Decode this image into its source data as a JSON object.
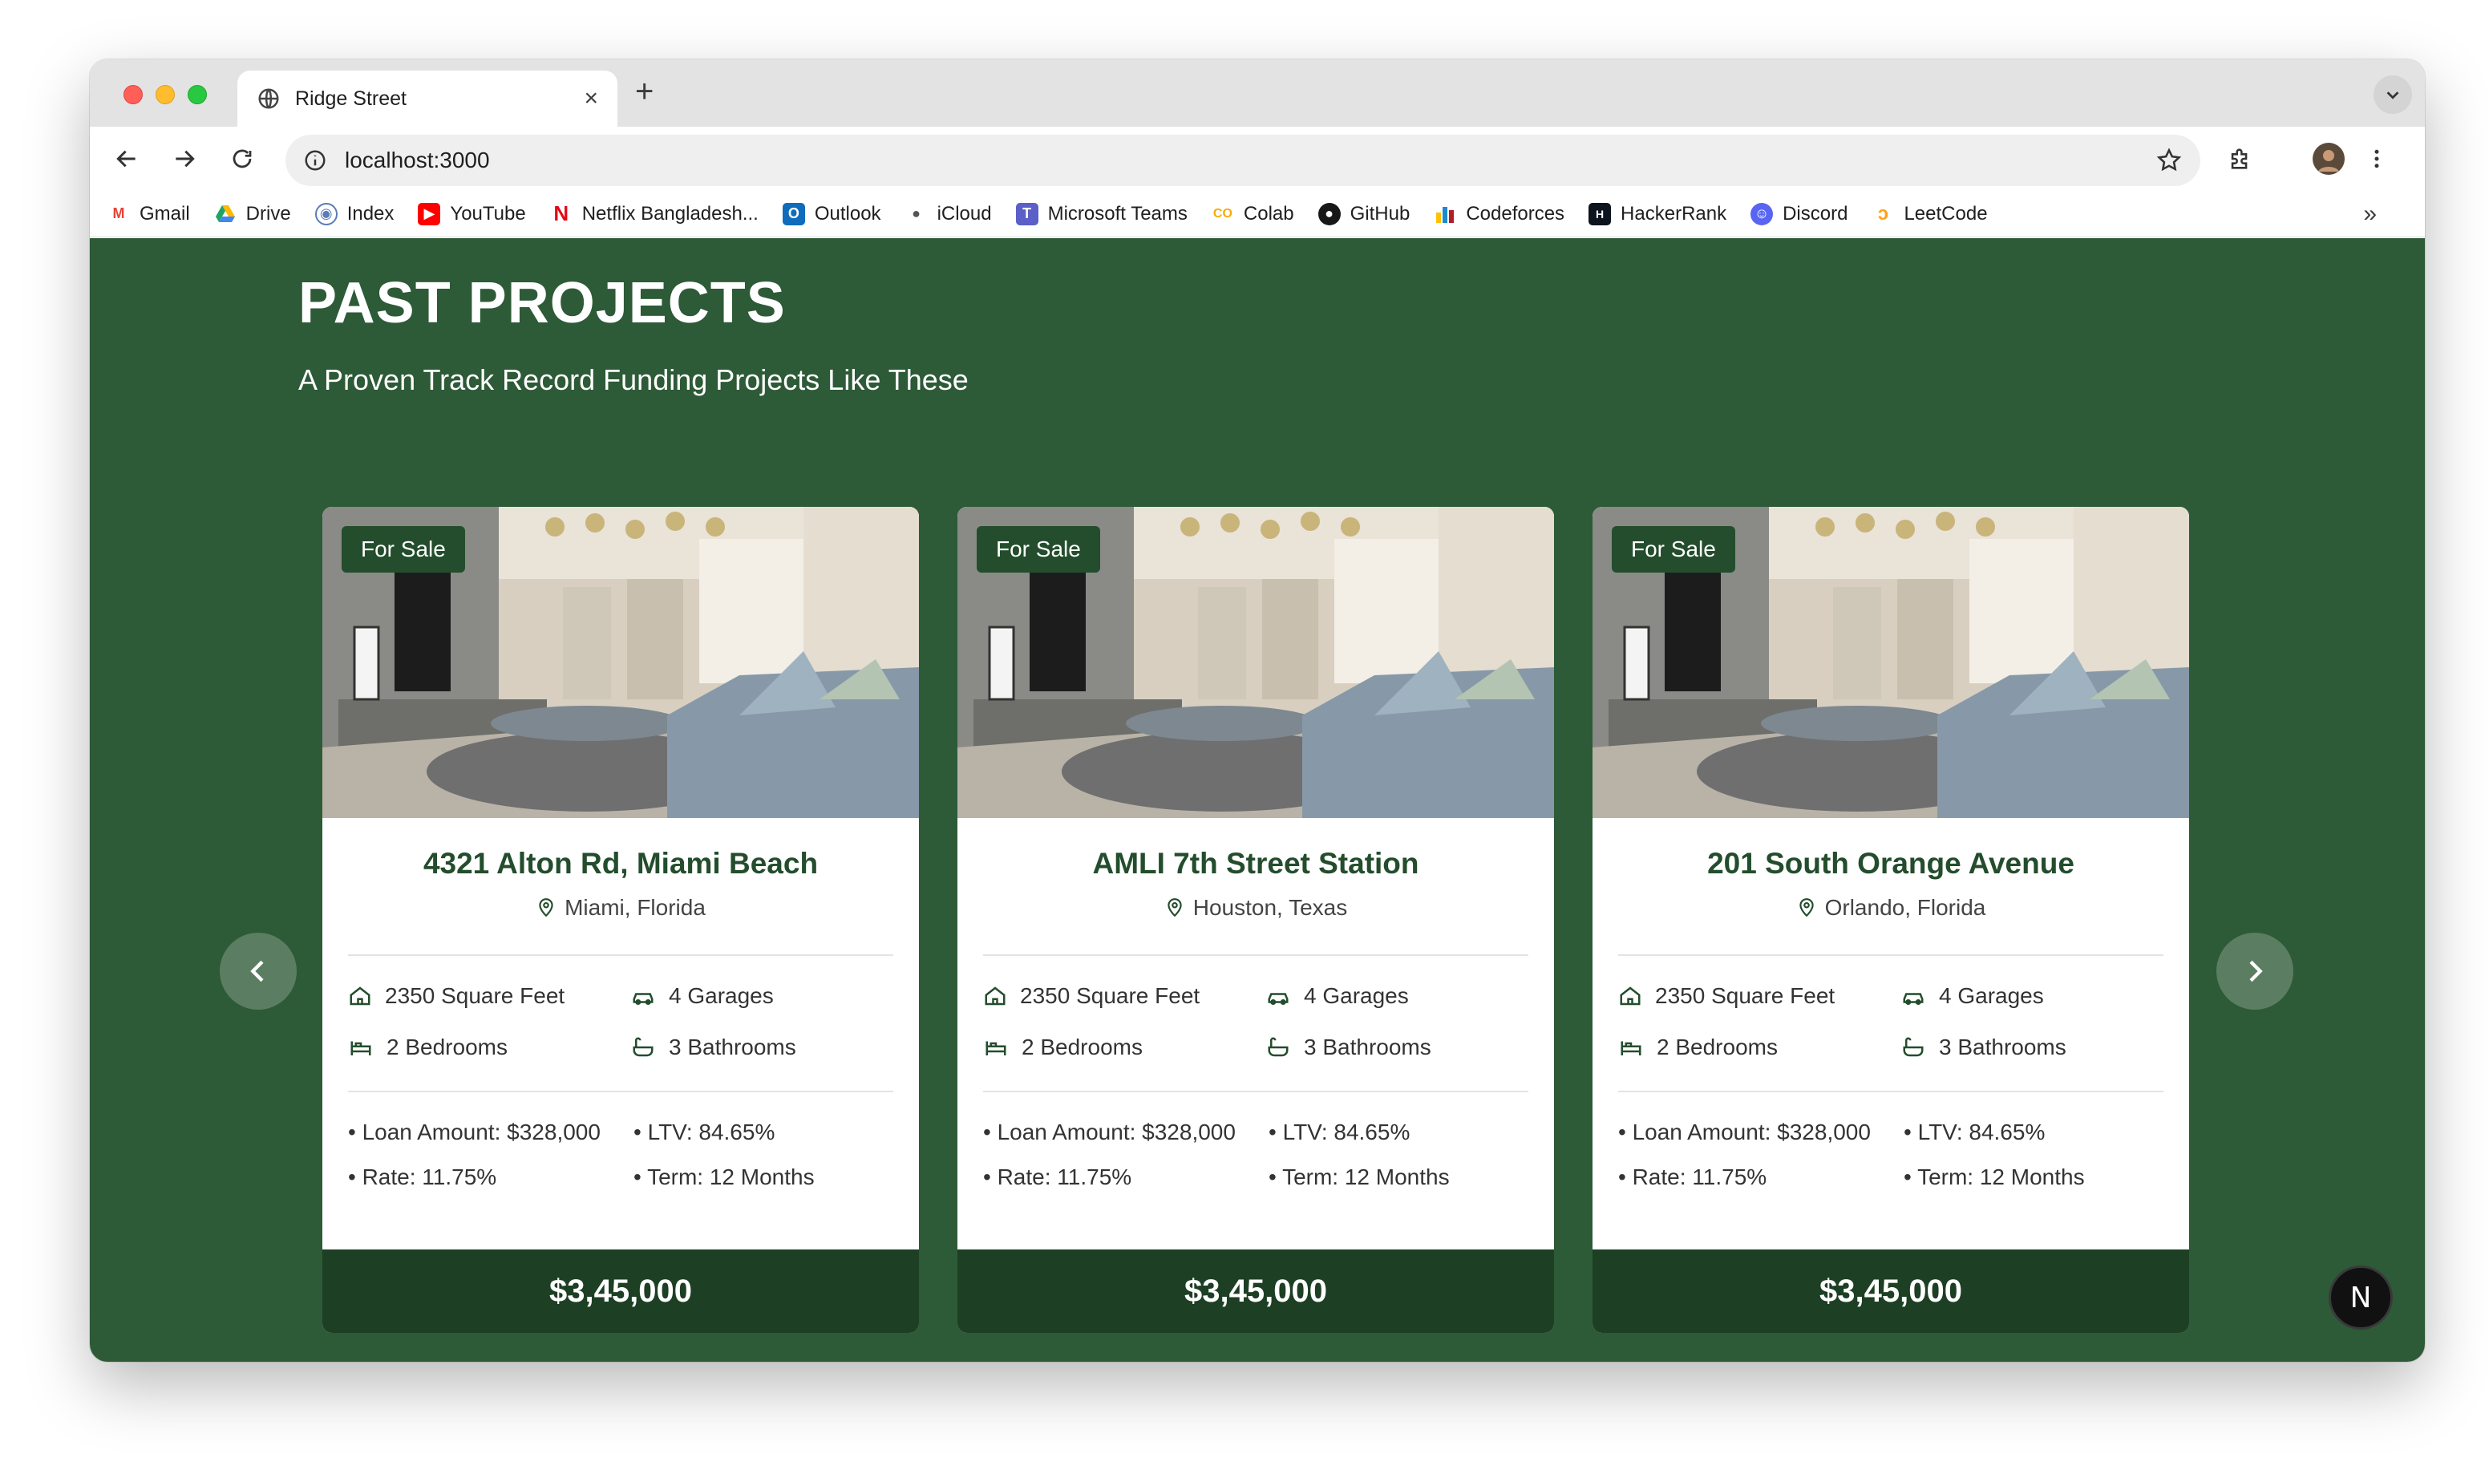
{
  "browser": {
    "tab_title": "Ridge Street",
    "url": "localhost:3000",
    "bookmarks": [
      {
        "label": "Gmail",
        "icon": "gmail-icon",
        "color": "#ea4335"
      },
      {
        "label": "Drive",
        "icon": "drive-icon",
        "color": "#1fa463"
      },
      {
        "label": "Index",
        "icon": "index-icon",
        "color": "#5b7bb8"
      },
      {
        "label": "YouTube",
        "icon": "youtube-icon",
        "color": "#ff0000"
      },
      {
        "label": "Netflix Bangladesh...",
        "icon": "netflix-icon",
        "color": "#e50914"
      },
      {
        "label": "Outlook",
        "icon": "outlook-icon",
        "color": "#0f6cbd"
      },
      {
        "label": "iCloud",
        "icon": "apple-icon",
        "color": "#555555"
      },
      {
        "label": "Microsoft Teams",
        "icon": "teams-icon",
        "color": "#5b5fc7"
      },
      {
        "label": "Colab",
        "icon": "colab-icon",
        "color": "#f9ab00"
      },
      {
        "label": "GitHub",
        "icon": "github-icon",
        "color": "#181717"
      },
      {
        "label": "Codeforces",
        "icon": "codeforces-icon",
        "color": "#1f8acb"
      },
      {
        "label": "HackerRank",
        "icon": "hackerrank-icon",
        "color": "#0e141e"
      },
      {
        "label": "Discord",
        "icon": "discord-icon",
        "color": "#5865f2"
      },
      {
        "label": "LeetCode",
        "icon": "leetcode-icon",
        "color": "#ffa116"
      }
    ]
  },
  "page": {
    "title": "PAST PROJECTS",
    "subtitle": "A Proven Track Record Funding Projects Like These",
    "bg_color": "#2d5a37",
    "accent_color": "#234d2c",
    "cards": [
      {
        "badge": "For Sale",
        "name": "4321 Alton Rd, Miami Beach",
        "location": "Miami, Florida",
        "square_feet": "2350 Square Feet",
        "garages": "4 Garages",
        "bedrooms": "2 Bedrooms",
        "bathrooms": "3 Bathrooms",
        "loan": "• Loan Amount: $328,000",
        "ltv": "• LTV: 84.65%",
        "rate": "• Rate: 11.75%",
        "term": "• Term: 12 Months",
        "price": "$3,45,000"
      },
      {
        "badge": "For Sale",
        "name": "AMLI 7th Street Station",
        "location": "Houston, Texas",
        "square_feet": "2350 Square Feet",
        "garages": "4 Garages",
        "bedrooms": "2 Bedrooms",
        "bathrooms": "3 Bathrooms",
        "loan": "• Loan Amount: $328,000",
        "ltv": "• LTV: 84.65%",
        "rate": "• Rate: 11.75%",
        "term": "• Term: 12 Months",
        "price": "$3,45,000"
      },
      {
        "badge": "For Sale",
        "name": "201 South Orange Avenue",
        "location": "Orlando, Florida",
        "square_feet": "2350 Square Feet",
        "garages": "4 Garages",
        "bedrooms": "2 Bedrooms",
        "bathrooms": "3 Bathrooms",
        "loan": "• Loan Amount: $328,000",
        "ltv": "• LTV: 84.65%",
        "rate": "• Rate: 11.75%",
        "term": "• Term: 12 Months",
        "price": "$3,45,000"
      }
    ],
    "dev_badge": "N"
  }
}
